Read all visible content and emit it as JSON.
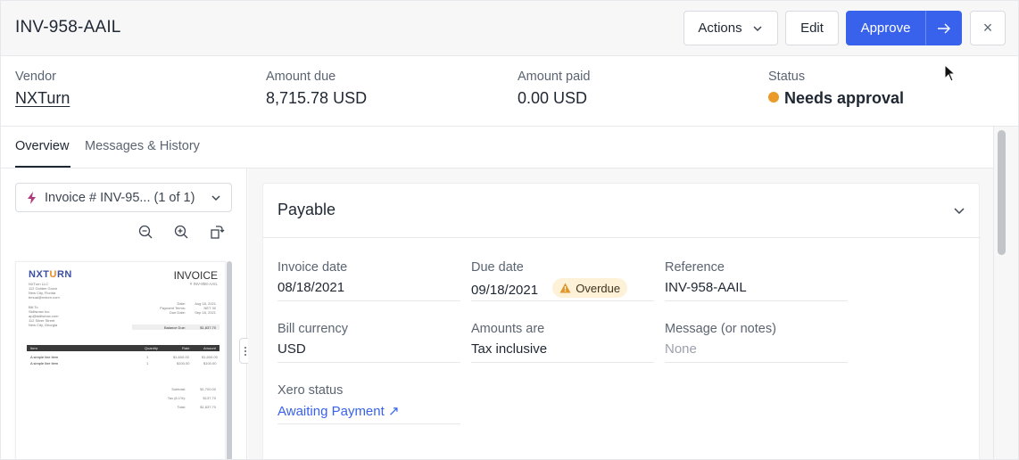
{
  "header": {
    "title": "INV-958-AAIL",
    "actions_label": "Actions",
    "edit_label": "Edit",
    "approve_label": "Approve",
    "next_label": "→",
    "close_label": "×"
  },
  "summary": {
    "vendor_label": "Vendor",
    "vendor_value": "NXTurn",
    "amount_due_label": "Amount due",
    "amount_due_value": "8,715.78 USD",
    "amount_paid_label": "Amount paid",
    "amount_paid_value": "0.00 USD",
    "status_label": "Status",
    "status_value": "Needs approval",
    "status_color": "#ea9a28"
  },
  "tabs": [
    {
      "label": "Overview",
      "active": true
    },
    {
      "label": "Messages & History",
      "active": false
    }
  ],
  "document": {
    "selector_label": "Invoice # INV-95... (1 of 1)",
    "tools": [
      "zoom-out-icon",
      "zoom-in-icon",
      "rotate-icon"
    ],
    "preview": {
      "logo_a": "NXT",
      "logo_b": "U",
      "logo_c": "RN",
      "heading": "INVOICE",
      "number": "# INV-958-AAIL",
      "vendor_lines": [
        "NXTurn LLC",
        "112 Golden Grove",
        "New City, Florida",
        "bmuai@nxturn.com"
      ],
      "bill_to_label": "Bill To",
      "bill_to_lines": [
        "Skillsmax Inc.",
        "ap@skillsmax.com",
        "112 Silver Street",
        "New City, Georgia"
      ],
      "meta": [
        {
          "label": "Date:",
          "value": "Aug 18, 2021"
        },
        {
          "label": "Payment Terms:",
          "value": "NET 30"
        },
        {
          "label": "Due Date:",
          "value": "Sep 18, 2021"
        }
      ],
      "balance_label": "Balance Due:",
      "balance_value": "$1,837.70",
      "table_headers": [
        "Item",
        "Quantity",
        "Rate",
        "Amount"
      ],
      "rows": [
        {
          "item": "A simple line item",
          "qty": "1",
          "rate": "$1,600.00",
          "amount": "$1,600.00"
        },
        {
          "item": "A simple line item",
          "qty": "1",
          "rate": "$100.00",
          "amount": "$100.00"
        }
      ],
      "totals": [
        {
          "label": "Subtotal:",
          "value": "$1,700.00"
        },
        {
          "label": "Tax (8.1%):",
          "value": "$137.70"
        },
        {
          "label": "Total:",
          "value": "$1,837.70"
        }
      ]
    }
  },
  "payable": {
    "title": "Payable",
    "fields": {
      "invoice_date_label": "Invoice date",
      "invoice_date_value": "08/18/2021",
      "due_date_label": "Due date",
      "due_date_value": "09/18/2021",
      "overdue_badge": "Overdue",
      "reference_label": "Reference",
      "reference_value": "INV-958-AAIL",
      "bill_currency_label": "Bill currency",
      "bill_currency_value": "USD",
      "amounts_are_label": "Amounts are",
      "amounts_are_value": "Tax inclusive",
      "message_label": "Message (or notes)",
      "message_value": "None",
      "xero_status_label": "Xero status",
      "xero_status_value": "Awaiting Payment ↗"
    }
  },
  "colors": {
    "primary": "#3862ec",
    "warning_bg": "#fdf1d8",
    "warning_icon": "#e0962a"
  }
}
